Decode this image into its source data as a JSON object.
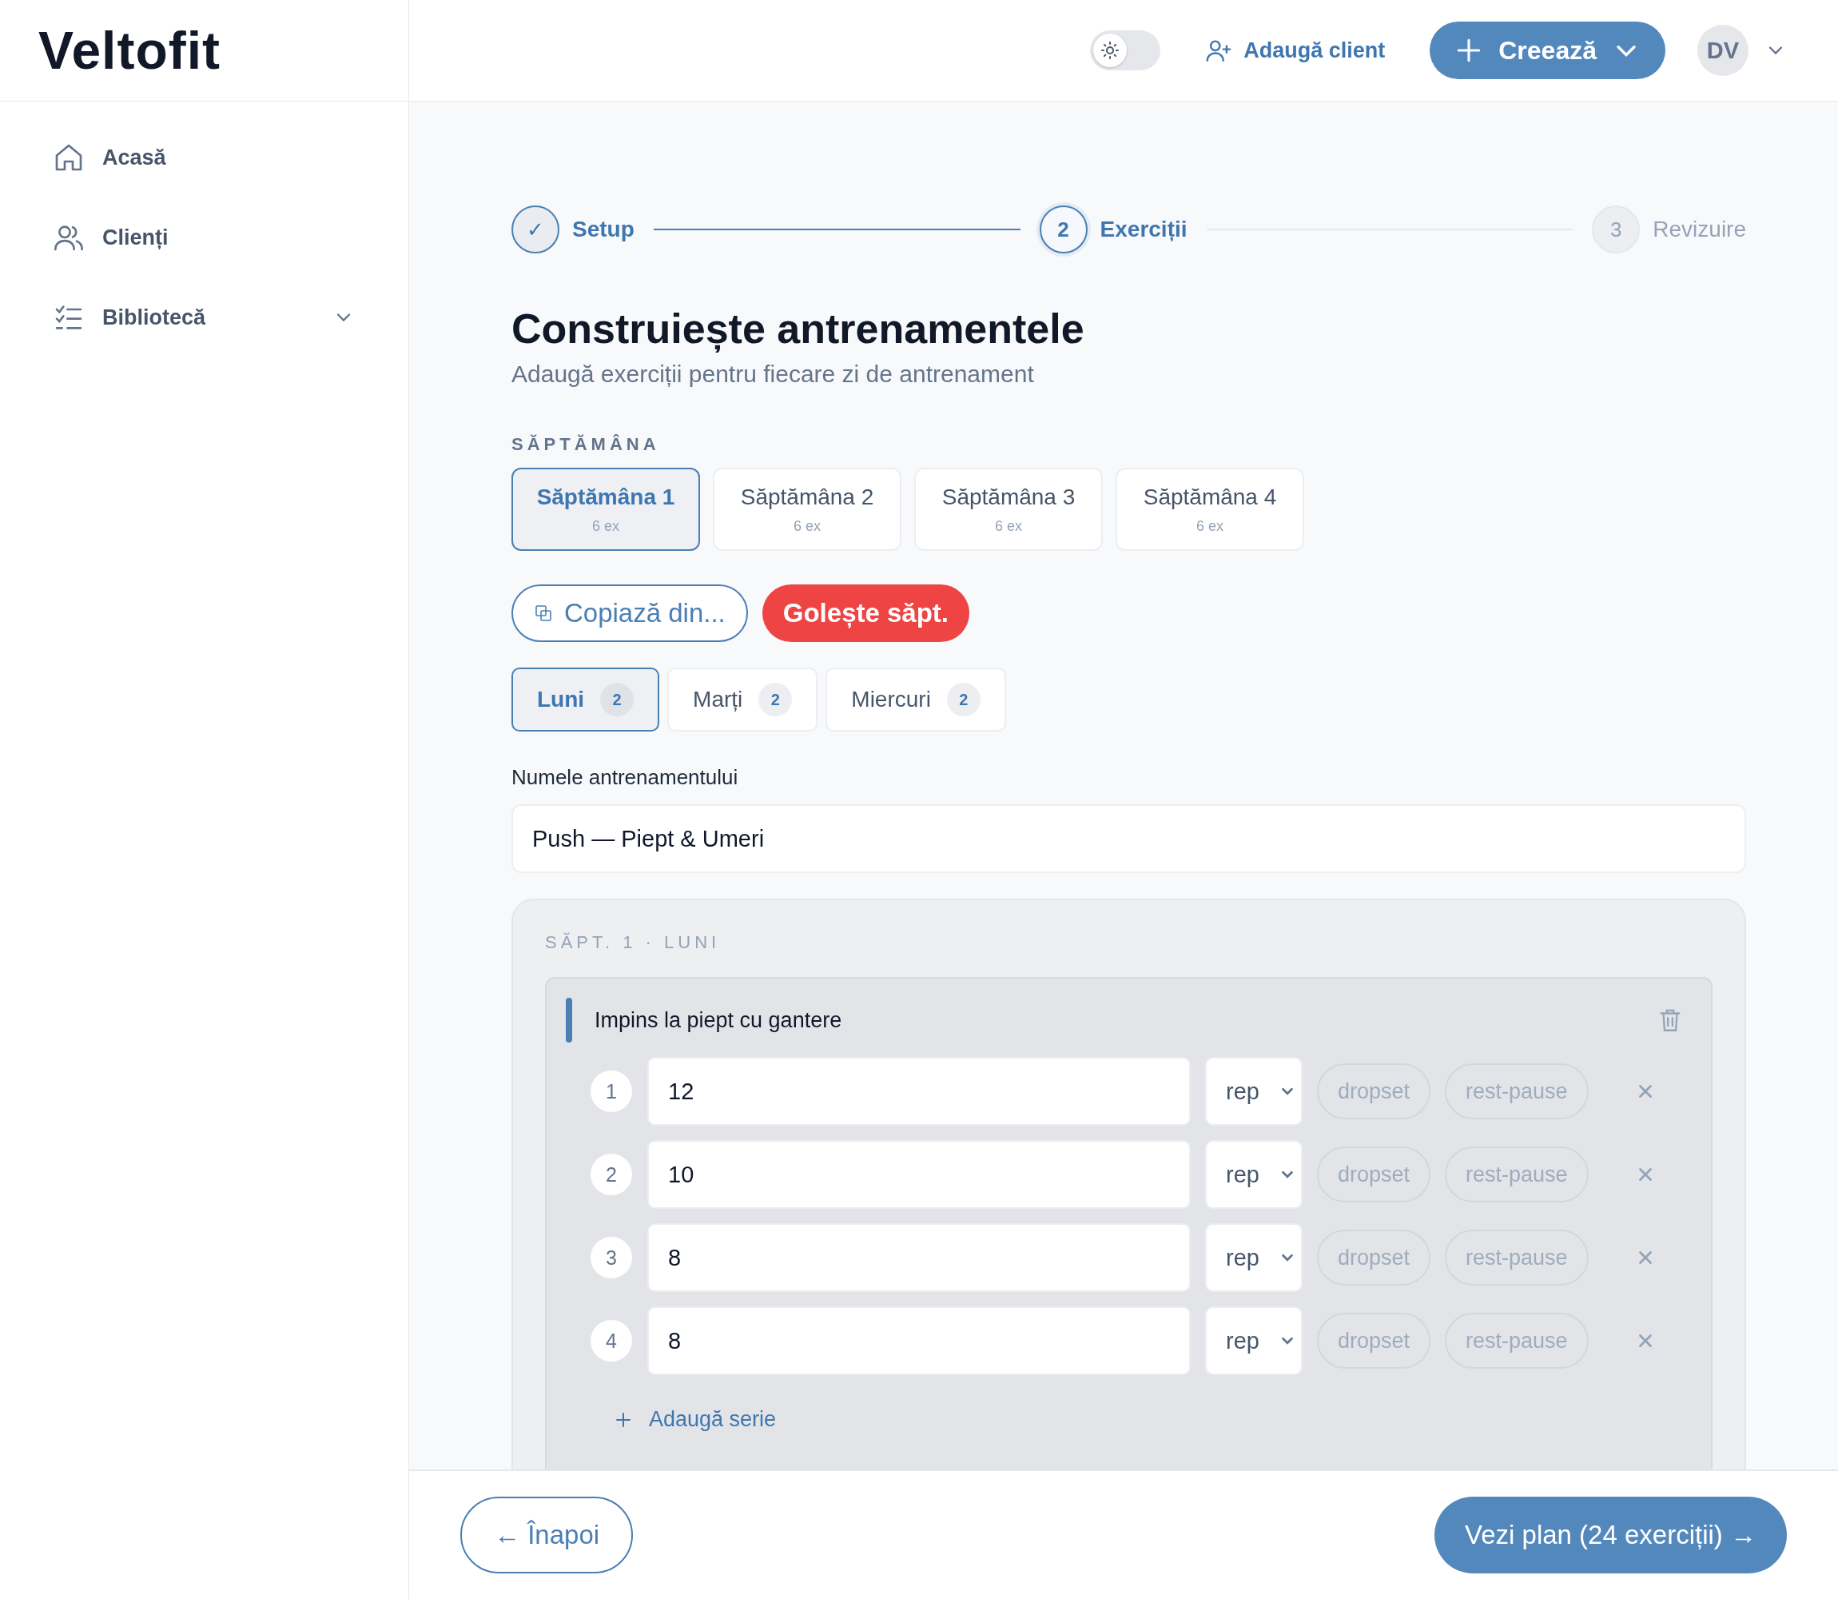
{
  "brand": {
    "logo": "Veltofit"
  },
  "header": {
    "theme_toggle": {
      "on": false
    },
    "add_client": "Adaugă client",
    "create": "Creează",
    "avatar": "DV"
  },
  "sidebar": {
    "items": [
      {
        "label": "Acasă",
        "kind": "home",
        "expandable": false
      },
      {
        "label": "Clienți",
        "kind": "users",
        "expandable": false
      },
      {
        "label": "Bibliotecă",
        "kind": "list",
        "expandable": true
      }
    ]
  },
  "steps": [
    {
      "marker": "✓",
      "label": "Setup",
      "completed": true,
      "selected": false
    },
    {
      "marker": "2",
      "label": "Exerciții",
      "completed": false,
      "selected": true
    },
    {
      "marker": "3",
      "label": "Revizuire",
      "completed": false,
      "selected": false
    }
  ],
  "title": "Construiește antrenamentele",
  "subtitle": "Adaugă exerciții pentru fiecare zi de antrenament",
  "weeks_label": "SĂPTĂMÂNA",
  "weeks": [
    {
      "label": "Săptămâna 1",
      "count": "6 ex",
      "selected": true
    },
    {
      "label": "Săptămâna 2",
      "count": "6 ex",
      "selected": false
    },
    {
      "label": "Săptămâna 3",
      "count": "6 ex",
      "selected": false
    },
    {
      "label": "Săptămâna 4",
      "count": "6 ex",
      "selected": false
    }
  ],
  "week_actions": [
    {
      "label": "Copiază din...",
      "kind": "outline"
    },
    {
      "label": "Golește săpt.",
      "kind": "danger"
    }
  ],
  "days": [
    {
      "label": "Luni",
      "count": "2",
      "selected": true
    },
    {
      "label": "Marți",
      "count": "2",
      "selected": false
    },
    {
      "label": "Miercuri",
      "count": "2",
      "selected": false
    }
  ],
  "workout_name": {
    "label": "Numele antrenamentului",
    "value": "Push — Piept & Umeri"
  },
  "day_card": {
    "title": "SĂPT. 1 · LUNI",
    "exercises": [
      {
        "name": "Impins la piept cu gantere",
        "sets": [
          {
            "number": "1",
            "value": "12",
            "unit": "rep",
            "tags": [
              {
                "label": "dropset",
                "on": false
              },
              {
                "label": "rest-pause",
                "on": false
              }
            ]
          },
          {
            "number": "2",
            "value": "10",
            "unit": "rep",
            "tags": [
              {
                "label": "dropset",
                "on": false
              },
              {
                "label": "rest-pause",
                "on": false
              }
            ]
          },
          {
            "number": "3",
            "value": "8",
            "unit": "rep",
            "tags": [
              {
                "label": "dropset",
                "on": false
              },
              {
                "label": "rest-pause",
                "on": false
              }
            ]
          },
          {
            "number": "4",
            "value": "8",
            "unit": "rep",
            "tags": [
              {
                "label": "dropset",
                "on": false
              },
              {
                "label": "rest-pause",
                "on": false
              }
            ]
          }
        ],
        "add_set": "Adaugă serie"
      }
    ]
  },
  "footer": {
    "back": "← Înapoi",
    "next": "Vezi plan (24 exerciții) →"
  }
}
